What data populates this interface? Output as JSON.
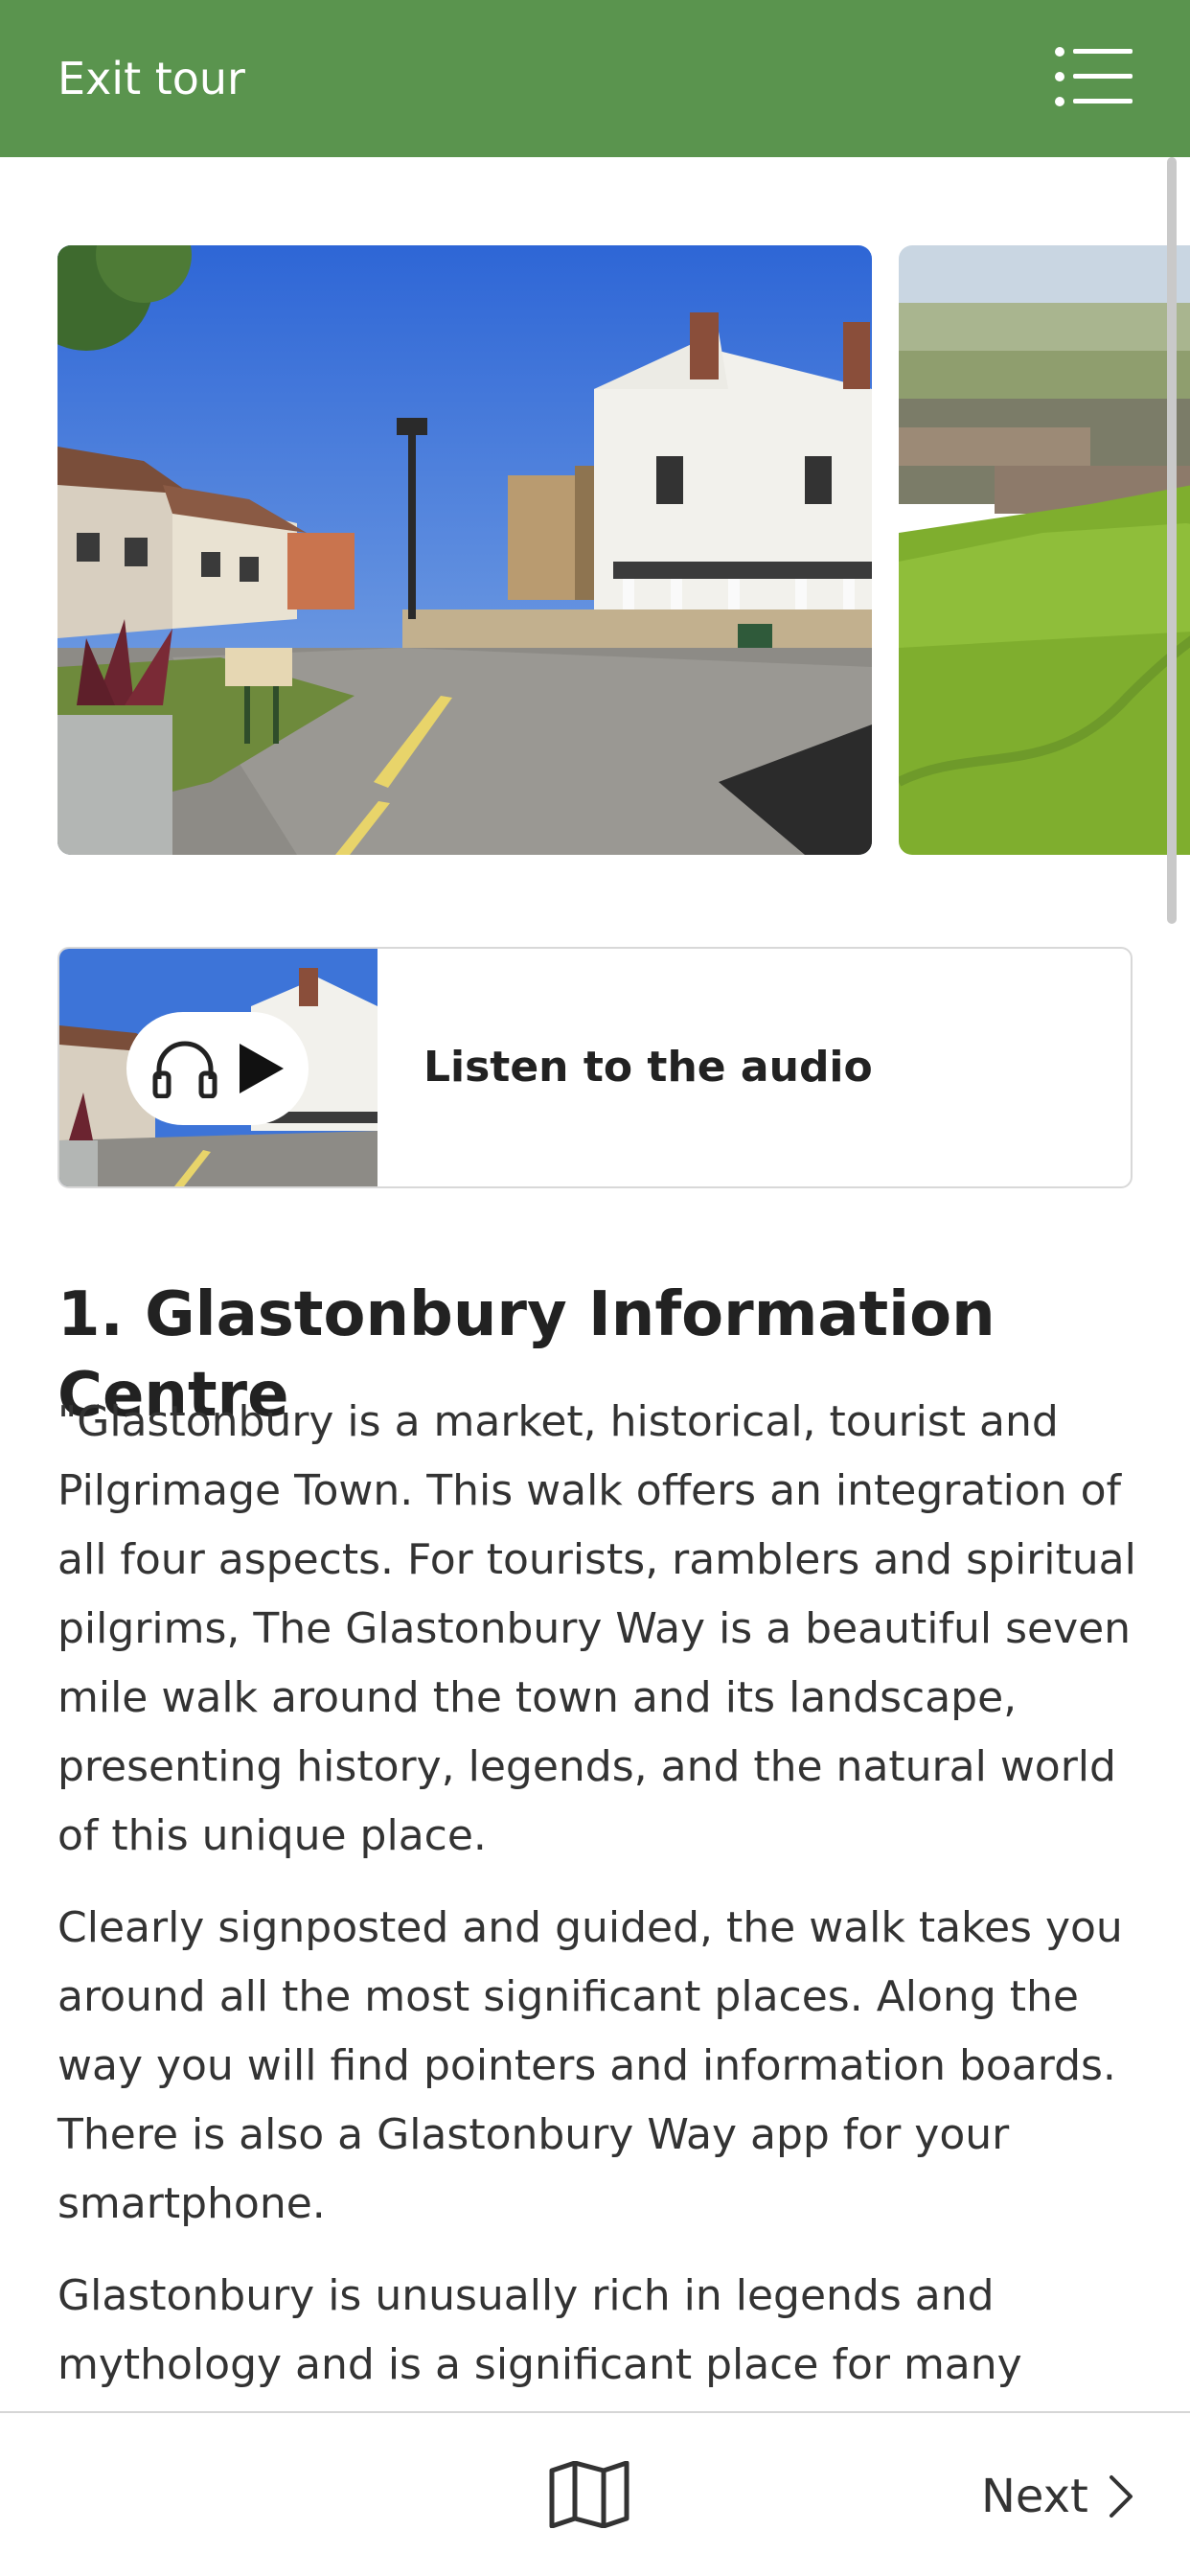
{
  "header": {
    "exit_label": "Exit tour",
    "menu_icon": "list-menu-icon",
    "background_color": "#5a944e"
  },
  "gallery": {
    "images": [
      {
        "name": "glastonbury-information-centre-photo"
      },
      {
        "name": "glastonbury-landscape-photo"
      }
    ]
  },
  "audio": {
    "label": "Listen to the audio",
    "icons": [
      "headphones-icon",
      "play-icon"
    ]
  },
  "stop": {
    "title": "1. Glastonbury Information Centre",
    "paragraphs": [
      "\"Glastonbury is a market, historical, tourist and Pilgrimage Town. This walk offers an integration of all four aspects. For tourists, ramblers and spiritual pilgrims, The Glastonbury Way is a beautiful seven mile walk around the town and its landscape, presenting history, legends, and the natural world of this unique place.",
      "Clearly signposted and guided, the walk takes you around all the most significant places. Along the way you will find pointers and information boards. There is also a Glastonbury Way app for your smartphone.",
      "Glastonbury is unusually rich in legends and mythology and is a significant place for many"
    ]
  },
  "footer": {
    "map_icon": "map-icon",
    "next_label": "Next",
    "next_icon": "chevron-right-icon"
  }
}
